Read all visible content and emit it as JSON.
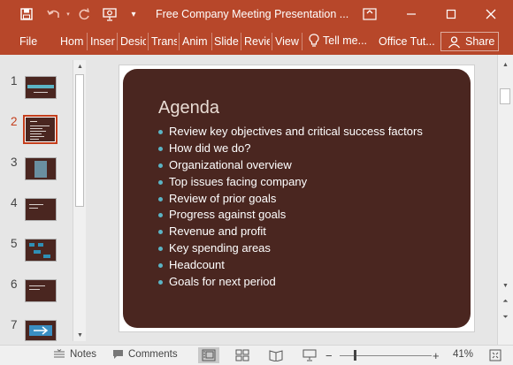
{
  "titlebar": {
    "document_title": "Free Company Meeting Presentation ...",
    "icons": [
      "save-icon",
      "undo-icon",
      "redo-icon",
      "present-icon",
      "customize-qat-icon",
      "ribbon-display-icon",
      "minimize-icon",
      "maximize-icon",
      "close-icon"
    ]
  },
  "ribbon": {
    "tabs": [
      "File",
      "Hom",
      "Inser",
      "Desic",
      "Trans",
      "Anim",
      "Slide",
      "Revie",
      "View"
    ],
    "tell_me": "Tell me...",
    "office_tutorial": "Office Tut...",
    "share": "Share"
  },
  "thumbnails": {
    "numbers": [
      "1",
      "2",
      "3",
      "4",
      "5",
      "6",
      "7"
    ],
    "active_index": 2,
    "slide_color": "#4a2620",
    "accent": "#c43e1c"
  },
  "slide": {
    "title": "Agenda",
    "bullets": [
      "Review key objectives and critical success factors",
      "How did we do?",
      "Organizational overview",
      "Top issues facing company",
      "Review of prior goals",
      "Progress against goals",
      "Revenue and profit",
      "Key spending areas",
      "Headcount",
      "Goals for next period"
    ],
    "background": "#4a2620",
    "bullet_color": "#5bb4c5"
  },
  "statusbar": {
    "notes": "Notes",
    "comments": "Comments",
    "zoom_level": "41%",
    "zoom_fraction": 0.41
  }
}
